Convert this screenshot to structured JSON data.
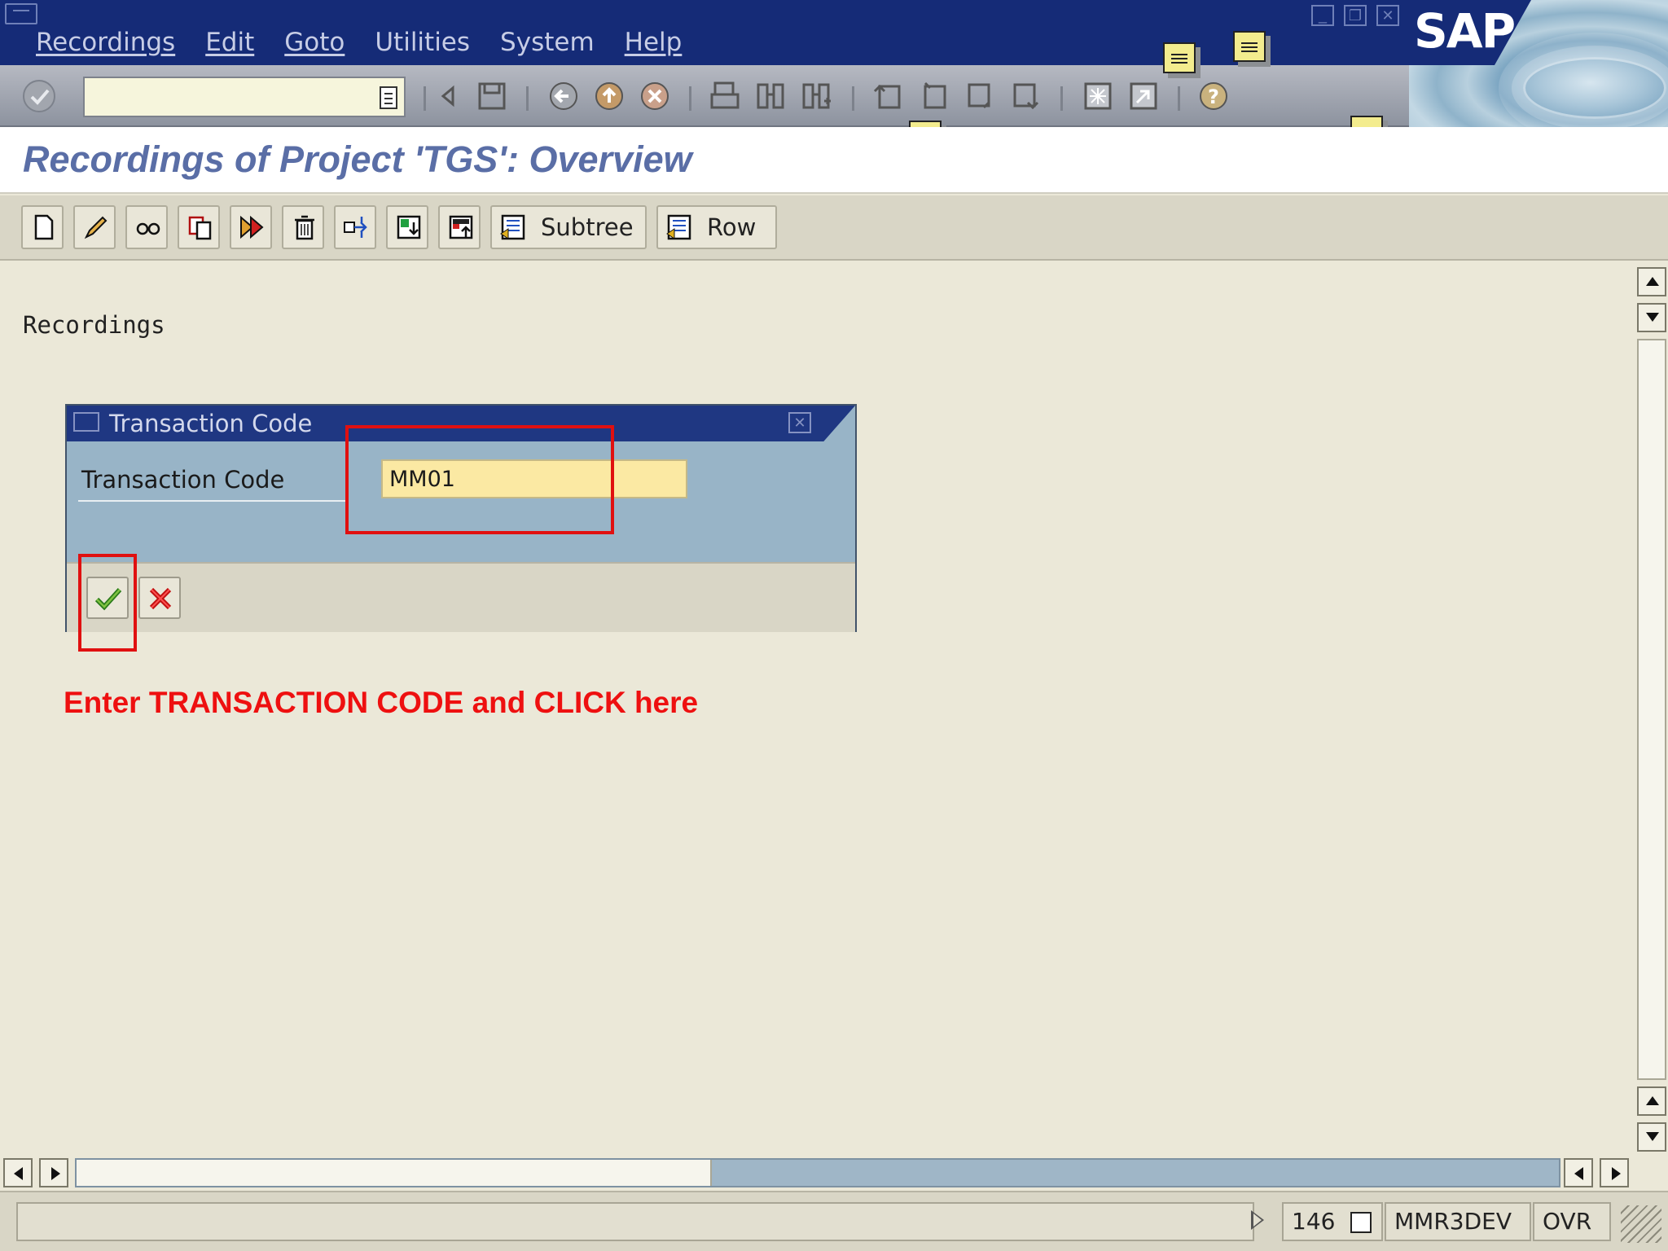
{
  "window": {
    "menu": [
      {
        "label": "Recordings"
      },
      {
        "label": "Edit"
      },
      {
        "label": "Goto"
      },
      {
        "label": "Utilities"
      },
      {
        "label": "System"
      },
      {
        "label": "Help"
      }
    ],
    "logo": "SAP"
  },
  "standard_toolbar": {
    "command_field_value": "",
    "icons": [
      "enter-icon",
      "back-icon",
      "save-icon",
      "back-nav-icon",
      "exit-icon",
      "cancel-icon",
      "print-icon",
      "find-icon",
      "find-next-icon",
      "first-page-icon",
      "previous-page-icon",
      "next-page-icon",
      "last-page-icon",
      "create-session-icon",
      "shortcut-icon",
      "help-icon"
    ]
  },
  "screen": {
    "title": "Recordings of Project 'TGS': Overview"
  },
  "app_toolbar": {
    "buttons": [
      {
        "icon": "create-icon"
      },
      {
        "icon": "change-icon"
      },
      {
        "icon": "display-icon"
      },
      {
        "icon": "copy-icon"
      },
      {
        "icon": "execute-icon"
      },
      {
        "icon": "delete-icon"
      },
      {
        "icon": "move-icon"
      },
      {
        "icon": "import-icon"
      },
      {
        "icon": "export-icon"
      },
      {
        "icon": "expand-subtree-icon",
        "label": "Subtree"
      },
      {
        "icon": "expand-row-icon",
        "label": "Row"
      }
    ]
  },
  "main": {
    "section_label": "Recordings",
    "dialog": {
      "title": "Transaction Code",
      "field_label": "Transaction Code",
      "field_value": "MM01"
    },
    "instruction": "Enter TRANSACTION CODE and CLICK here"
  },
  "status_bar": {
    "session": "146",
    "server": "MMR3DEV",
    "mode": "OVR"
  },
  "colors": {
    "title_bar": "#152b77",
    "screen_title": "#5a6ea6",
    "input_required": "#fbe9a3",
    "highlight": "#e01010",
    "background": "#ebe8d8"
  }
}
